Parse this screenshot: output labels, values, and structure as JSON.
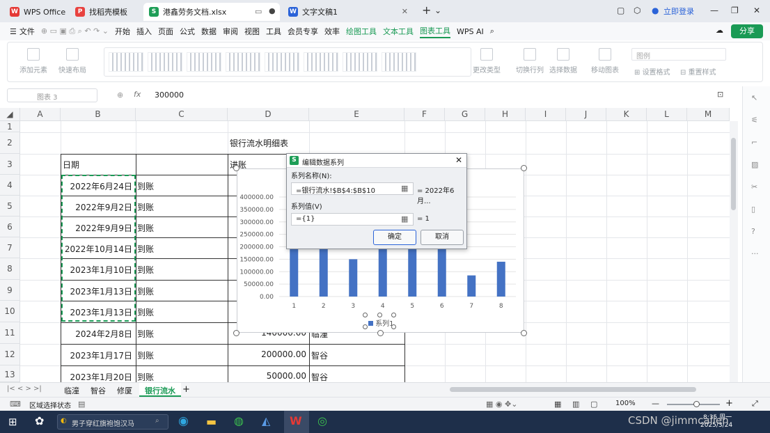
{
  "tabs": [
    {
      "label": "WPS Office",
      "icon": "wps-icon"
    },
    {
      "label": "找稻壳模板",
      "icon": "docer-icon"
    },
    {
      "label": "港鑫劳务文档.xlsx",
      "icon": "sheet-icon",
      "ic_text": "S"
    },
    {
      "label": "文字文稿1",
      "icon": "writer-icon",
      "ic_text": "W"
    }
  ],
  "login_label": "立即登录",
  "menu": [
    "文件",
    "开始",
    "插入",
    "页面",
    "公式",
    "数据",
    "审阅",
    "视图",
    "工具",
    "会员专享",
    "效率"
  ],
  "context_menu": [
    "绘图工具",
    "文本工具",
    "图表工具"
  ],
  "wps_ai": "WPS AI",
  "share_label": "分享",
  "ribbon": {
    "add_element": "添加元素",
    "quick_layout": "快速布局",
    "change_type": "更改类型",
    "switch_rowcol": "切换行列",
    "select_data": "选择数据",
    "move_chart": "移动图表",
    "legend_select": "图例",
    "set_format": "设置格式",
    "reset_style": "重置样式"
  },
  "formula_bar": {
    "name_box": "图表 3",
    "fx": "fx",
    "value": "300000"
  },
  "columns": [
    "A",
    "B",
    "C",
    "D",
    "E",
    "F",
    "G",
    "H",
    "I",
    "J",
    "K",
    "L",
    "M"
  ],
  "rows": [
    "1",
    "2",
    "3",
    "4",
    "5",
    "6",
    "7",
    "8",
    "9",
    "10",
    "11",
    "12",
    "13"
  ],
  "sheet": {
    "title": "银行流水明细表",
    "header_date": "日期",
    "header_income": "进账",
    "dates": [
      "2022年6月24日",
      "2022年9月2日",
      "2022年9月9日",
      "2022年10月14日",
      "2023年1月10日",
      "2023年1月13日",
      "2023年1月13日",
      "2024年2月8日",
      "2023年1月17日",
      "2023年1月20日"
    ],
    "status": "到账",
    "row11_amount": "140000.00",
    "row11_company": "临潼",
    "row12_amount": "200000.00",
    "row12_company": "智谷",
    "row13_amount": "50000.00",
    "row13_company": "智谷"
  },
  "chart_data": {
    "type": "bar",
    "categories": [
      "1",
      "2",
      "3",
      "4",
      "5",
      "6",
      "7",
      "8"
    ],
    "y_ticks": [
      "0.00",
      "50000.00",
      "100000.00",
      "150000.00",
      "200000.00",
      "250000.00",
      "300000.00",
      "350000.00",
      "400000.00"
    ],
    "ylim": [
      0,
      400000
    ],
    "series": [
      {
        "name": "系列1",
        "values": [
          200000,
          200000,
          150000,
          200000,
          200000,
          200000,
          85000,
          140000
        ]
      }
    ],
    "bar_color": "#4472c4",
    "legend_position": "bottom",
    "grid": true
  },
  "dialog": {
    "title": "编辑数据系列",
    "name_label": "系列名称(N):",
    "name_value": "=银行流水!$B$4:$B$10",
    "name_result": "= 2022年6月...",
    "values_label": "系列值(V)",
    "values_value": "={1}",
    "values_result": "= 1",
    "ok": "确定",
    "cancel": "取消"
  },
  "sheet_tabs": [
    "临潼",
    "智谷",
    "修厦",
    "银行流水"
  ],
  "active_sheet": "银行流水",
  "status": {
    "area_status": "区域选择状态",
    "zoom": "100%"
  },
  "taskbar": {
    "search_text": "男子穿红旗袍饱汉马",
    "time": "8:35 周一",
    "date": "2025/3/24",
    "watermark": "CSDN @jimmcallen"
  }
}
